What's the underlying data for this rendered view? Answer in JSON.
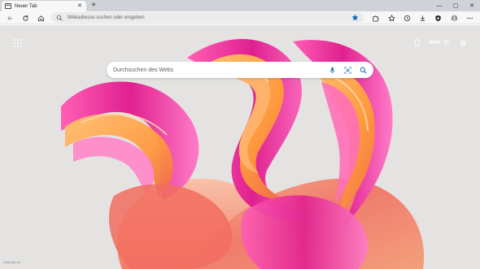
{
  "tab": {
    "title": "Neuer Tab"
  },
  "window_controls": {
    "minimize": "—",
    "maximize": "▢",
    "close": "✕"
  },
  "toolbar": {
    "address_placeholder": "Webadresse suchen oder eingeben"
  },
  "newtab": {
    "search_placeholder": "Durchsuchen des Webs",
    "rewards_points": "8400",
    "image_credit": "Hintergrund"
  },
  "colors": {
    "accent": "#0f6cbd",
    "tab_strip": "#cfd2d6",
    "toolbar": "#f7f7f7",
    "wallpaper_bg": "#e4e3e2"
  },
  "icons": {
    "back": "back-arrow-icon",
    "refresh": "refresh-icon",
    "home": "home-icon",
    "search": "search-icon",
    "favorite": "star-icon",
    "extensions": "puzzle-icon",
    "favorites": "favorites-icon",
    "history": "history-icon",
    "downloads": "download-icon",
    "wallet": "shield-icon",
    "profile": "profile-icon",
    "more": "more-icon",
    "mic": "microphone-icon",
    "visual_search": "visual-search-icon",
    "apps": "apps-grid-icon",
    "phone": "phone-icon",
    "wifi": "wifi-icon",
    "settings": "gear-icon"
  }
}
